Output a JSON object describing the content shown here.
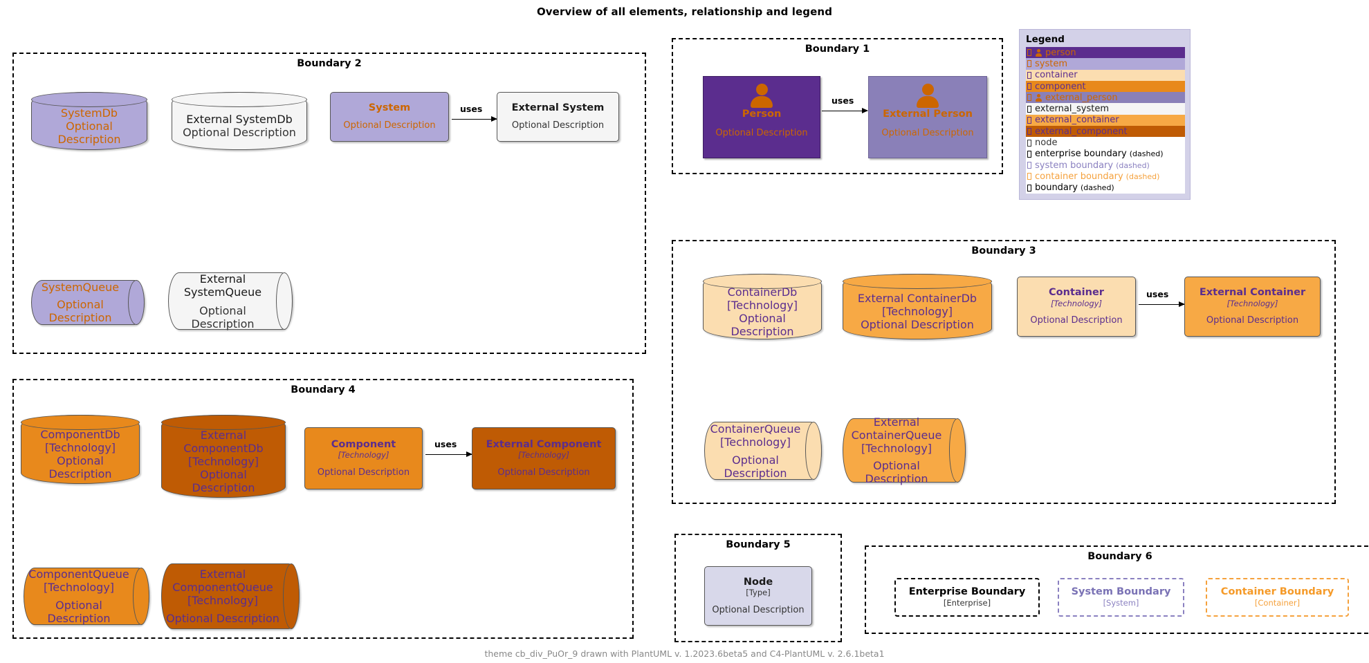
{
  "title": "Overview of all elements, relationship and legend",
  "footer": "theme cb_div_PuOr_9 drawn with PlantUML v. 1.2023.6beta5 and C4-PlantUML v. 2.6.1beta1",
  "labels": {
    "optional_description": "Optional Description",
    "technology": "[Technology]",
    "type": "[Type]",
    "uses": "uses"
  },
  "colors": {
    "person_fill": "#5b2d8e",
    "person_text": "#cc6600",
    "external_person_fill": "#8a80b8",
    "system_fill": "#b0a8d8",
    "system_text": "#cc6600",
    "external_system_fill": "#f5f5f5",
    "external_system_text": "#1a1a1a",
    "container_fill": "#fbddb0",
    "external_container_fill": "#f7a945",
    "component_fill": "#e8891c",
    "external_component_fill": "#bf5b04",
    "component_text": "#5b2d8e",
    "node_fill": "#d8d8ea",
    "node_text": "#333333",
    "legend_bg": "#d3d1e8",
    "system_boundary": "#8a80c0",
    "container_boundary": "#f5a13c"
  },
  "boundaries": {
    "b1": {
      "title": "Boundary 1"
    },
    "b2": {
      "title": "Boundary 2"
    },
    "b3": {
      "title": "Boundary 3"
    },
    "b4": {
      "title": "Boundary 4"
    },
    "b5": {
      "title": "Boundary 5"
    },
    "b6": {
      "title": "Boundary 6"
    }
  },
  "elements": {
    "person": {
      "name": "Person",
      "desc": "Optional Description"
    },
    "external_person": {
      "name": "External Person",
      "desc": "Optional Description"
    },
    "system_db": {
      "name": "SystemDb",
      "desc": "Optional Description"
    },
    "external_system_db": {
      "name": "External SystemDb",
      "desc": "Optional Description"
    },
    "system": {
      "name": "System",
      "desc": "Optional Description"
    },
    "external_system": {
      "name": "External System",
      "desc": "Optional Description"
    },
    "system_queue": {
      "name": "SystemQueue",
      "desc": "Optional Description"
    },
    "external_system_queue": {
      "name": "External\nSystemQueue",
      "desc": "Optional Description"
    },
    "container_db": {
      "name": "ContainerDb",
      "tech": "[Technology]",
      "desc": "Optional Description"
    },
    "external_container_db": {
      "name": "External ContainerDb",
      "tech": "[Technology]",
      "desc": "Optional Description"
    },
    "container": {
      "name": "Container",
      "tech": "[Technology]",
      "desc": "Optional Description"
    },
    "external_container": {
      "name": "External Container",
      "tech": "[Technology]",
      "desc": "Optional Description"
    },
    "container_queue": {
      "name": "ContainerQueue",
      "tech": "[Technology]",
      "desc": "Optional Description"
    },
    "external_container_queue": {
      "name": "External\nContainerQueue",
      "tech": "[Technology]",
      "desc": "Optional Description"
    },
    "component_db": {
      "name": "ComponentDb",
      "tech": "[Technology]",
      "desc": "Optional Description"
    },
    "external_component_db": {
      "name": "External\nComponentDb",
      "tech": "[Technology]",
      "desc": "Optional Description"
    },
    "component": {
      "name": "Component",
      "tech": "[Technology]",
      "desc": "Optional Description"
    },
    "external_component": {
      "name": "External Component",
      "tech": "[Technology]",
      "desc": "Optional Description"
    },
    "component_queue": {
      "name": "ComponentQueue",
      "tech": "[Technology]",
      "desc": "Optional Description"
    },
    "external_component_queue": {
      "name": "External\nComponentQueue",
      "tech": "[Technology]",
      "desc": "Optional Description"
    },
    "node": {
      "name": "Node",
      "tech": "[Type]",
      "desc": "Optional Description"
    },
    "enterprise_boundary": {
      "name": "Enterprise Boundary",
      "type": "[Enterprise]"
    },
    "system_boundary_el": {
      "name": "System Boundary",
      "type": "[System]"
    },
    "container_boundary_el": {
      "name": "Container Boundary",
      "type": "[Container]"
    }
  },
  "relationships": [
    {
      "id": "system-uses-external-system",
      "label": "uses"
    },
    {
      "id": "person-uses-external-person",
      "label": "uses"
    },
    {
      "id": "container-uses-external-container",
      "label": "uses"
    },
    {
      "id": "component-uses-external-component",
      "label": "uses"
    }
  ],
  "legend": {
    "title": "Legend",
    "items": [
      {
        "label": "person",
        "sub": "",
        "bg": "#5b2d8e",
        "fg": "#cc6600",
        "person": true,
        "icon": "person-glyph"
      },
      {
        "label": "system",
        "sub": "",
        "bg": "#b0a8d8",
        "fg": "#cc6600",
        "person": false,
        "icon": "tofu-glyph"
      },
      {
        "label": "container",
        "sub": "",
        "bg": "#fbddb0",
        "fg": "#5b2d8e",
        "person": false,
        "icon": "tofu-glyph"
      },
      {
        "label": "component",
        "sub": "",
        "bg": "#e8891c",
        "fg": "#5b2d8e",
        "person": false,
        "icon": "tofu-glyph"
      },
      {
        "label": "external_person",
        "sub": "",
        "bg": "#8a80b8",
        "fg": "#cc6600",
        "person": true,
        "icon": "person-glyph"
      },
      {
        "label": "external_system",
        "sub": "",
        "bg": "#f5f5f5",
        "fg": "#1a1a1a",
        "person": false,
        "icon": "tofu-glyph"
      },
      {
        "label": "external_container",
        "sub": "",
        "bg": "#f7a945",
        "fg": "#5b2d8e",
        "person": false,
        "icon": "tofu-glyph"
      },
      {
        "label": "external_component",
        "sub": "",
        "bg": "#bf5b04",
        "fg": "#5b2d8e",
        "person": false,
        "icon": "tofu-glyph"
      },
      {
        "label": "node",
        "sub": "",
        "bg": "#ffffff",
        "fg": "#333333",
        "person": false,
        "icon": "tofu-glyph"
      },
      {
        "label": "enterprise boundary",
        "sub": "(dashed)",
        "bg": "#ffffff",
        "fg": "#000000",
        "person": false,
        "icon": "tofu-glyph"
      },
      {
        "label": "system boundary",
        "sub": "(dashed)",
        "bg": "#ffffff",
        "fg": "#8a80c0",
        "person": false,
        "icon": "tofu-glyph"
      },
      {
        "label": "container boundary",
        "sub": "(dashed)",
        "bg": "#ffffff",
        "fg": "#f5a13c",
        "person": false,
        "icon": "tofu-glyph"
      },
      {
        "label": "boundary",
        "sub": "(dashed)",
        "bg": "#ffffff",
        "fg": "#000000",
        "person": false,
        "icon": "tofu-glyph"
      }
    ]
  }
}
